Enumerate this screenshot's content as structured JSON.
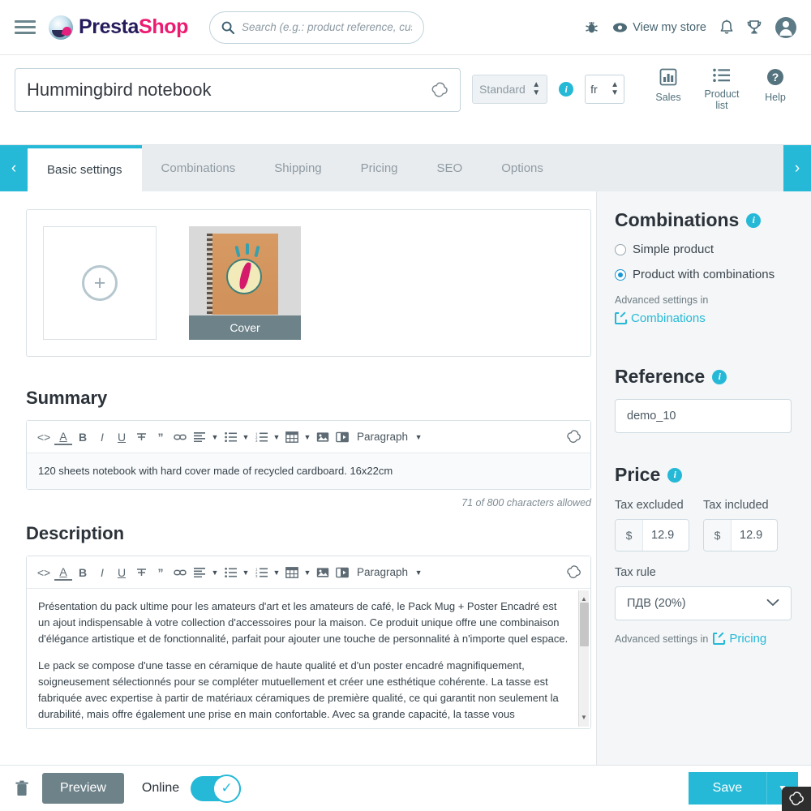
{
  "header": {
    "menu_icon": "hamburger-icon",
    "brand_presta": "Presta",
    "brand_shop": "Shop",
    "search_placeholder": "Search (e.g.: product reference, custon",
    "debug_icon": "bug-icon",
    "view_store_label": "View my store",
    "view_store_icon": "eye-icon",
    "notifications_icon": "bell-icon",
    "trophy_icon": "trophy-icon",
    "account_icon": "user-avatar-icon"
  },
  "product_header": {
    "title_value": "Hummingbird notebook",
    "title_placeholder": "Product name",
    "ai_icon": "sparkle-icon",
    "type_selected": "Standard",
    "type_info_icon": "info-icon",
    "language_selected": "fr",
    "tools": [
      {
        "label": "Sales",
        "icon": "bar-chart-icon"
      },
      {
        "label": "Product list",
        "icon": "list-icon"
      },
      {
        "label": "Help",
        "icon": "question-circle-icon"
      }
    ]
  },
  "tabs": {
    "prev_icon": "chevron-left-icon",
    "next_icon": "chevron-right-icon",
    "items": [
      {
        "label": "Basic settings",
        "active": true
      },
      {
        "label": "Combinations",
        "active": false
      },
      {
        "label": "Shipping",
        "active": false
      },
      {
        "label": "Pricing",
        "active": false
      },
      {
        "label": "SEO",
        "active": false
      },
      {
        "label": "Options",
        "active": false
      }
    ]
  },
  "images": {
    "add_icon": "plus-circle-icon",
    "cover_label": "Cover"
  },
  "summary": {
    "heading": "Summary",
    "text": "120 sheets notebook with hard cover made of recycled cardboard. 16x22cm",
    "char_count": "71 of 800 characters allowed"
  },
  "description": {
    "heading": "Description",
    "paragraph_1": "Présentation du pack ultime pour les amateurs d'art et les amateurs de café, le Pack Mug + Poster Encadré est un ajout indispensable à votre collection d'accessoires pour la maison. Ce produit unique offre une combinaison d'élégance artistique et de fonctionnalité, parfait pour ajouter une touche de personnalité à n'importe quel espace.",
    "paragraph_2": "Le pack se compose d'une tasse en céramique de haute qualité et d'un poster encadré magnifiquement, soigneusement sélectionnés pour se compléter mutuellement et créer une esthétique cohérente. La tasse est fabriquée avec expertise à partir de matériaux céramiques de première qualité, ce qui garantit non seulement la durabilité, mais offre également une prise en main confortable. Avec sa grande capacité, la tasse vous"
  },
  "editor_toolbar": {
    "paragraph_label": "Paragraph",
    "buttons": [
      {
        "icon": "source-code-icon",
        "glyph": "<>"
      },
      {
        "icon": "text-color-icon",
        "glyph": "A"
      },
      {
        "icon": "bold-icon",
        "glyph": "B"
      },
      {
        "icon": "italic-icon",
        "glyph": "I"
      },
      {
        "icon": "underline-icon",
        "glyph": "U"
      },
      {
        "icon": "strikethrough-icon",
        "glyph": "S"
      },
      {
        "icon": "blockquote-icon",
        "glyph": "”"
      },
      {
        "icon": "link-icon",
        "glyph": "⧉"
      },
      {
        "icon": "align-icon",
        "glyph": "≡"
      },
      {
        "icon": "bullet-list-icon",
        "glyph": "☰"
      },
      {
        "icon": "numbered-list-icon",
        "glyph": "≡"
      },
      {
        "icon": "table-icon",
        "glyph": "▦"
      },
      {
        "icon": "image-icon",
        "glyph": "▣"
      },
      {
        "icon": "video-icon",
        "glyph": "▶"
      }
    ],
    "ai_icon": "sparkle-icon"
  },
  "combinations": {
    "heading": "Combinations",
    "info_icon": "info-icon",
    "option_simple": "Simple product",
    "option_combinations": "Product with combinations",
    "selected": "combinations",
    "advanced_label": "Advanced settings in",
    "link_label": "Combinations",
    "link_icon": "external-link-icon"
  },
  "reference": {
    "heading": "Reference",
    "info_icon": "info-icon",
    "value": "demo_10"
  },
  "price": {
    "heading": "Price",
    "info_icon": "info-icon",
    "tax_excluded_label": "Tax excluded",
    "tax_excluded_symbol": "$",
    "tax_excluded_value": "12.9",
    "tax_included_label": "Tax included",
    "tax_included_symbol": "$",
    "tax_included_value": "12.9",
    "tax_rule_label": "Tax rule",
    "tax_rule_value": "ПДВ (20%)",
    "tax_rule_caret": "chevron-down-icon",
    "advanced_label": "Advanced settings in",
    "link_label": "Pricing",
    "link_icon": "external-link-icon"
  },
  "footer": {
    "delete_icon": "trash-icon",
    "preview_label": "Preview",
    "online_label": "Online",
    "online_state": "on",
    "toggle_check_icon": "check-icon",
    "save_label": "Save",
    "save_caret_icon": "chevron-down-icon"
  },
  "colors": {
    "accent": "#25b9d7",
    "brand_pink": "#ed1b6f",
    "brand_navy": "#251b5b",
    "slate": "#6d8289"
  }
}
